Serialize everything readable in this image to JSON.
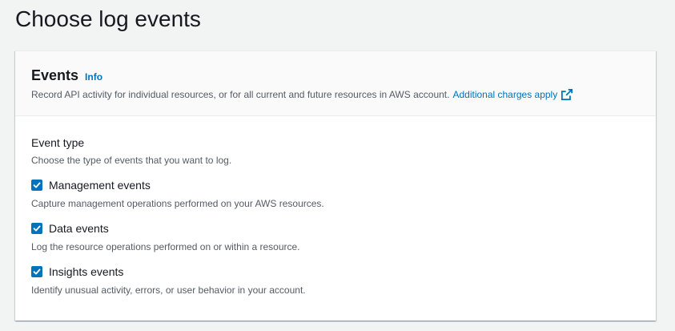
{
  "page": {
    "title": "Choose log events"
  },
  "events_panel": {
    "title": "Events",
    "info_label": "Info",
    "description": "Record API activity for individual resources, or for all current and future resources in AWS account.",
    "charges_link": "Additional charges apply",
    "charges_link_icon": "external-link-icon"
  },
  "event_type": {
    "label": "Event type",
    "description": "Choose the type of events that you want to log.",
    "options": [
      {
        "label": "Management events",
        "description": "Capture management operations performed on your AWS resources.",
        "checked": true
      },
      {
        "label": "Data events",
        "description": "Log the resource operations performed on or within a resource.",
        "checked": true
      },
      {
        "label": "Insights events",
        "description": "Identify unusual activity, errors, or user behavior in your account.",
        "checked": true
      }
    ]
  },
  "colors": {
    "accent": "#0073bb",
    "text": "#16191f",
    "muted": "#545b64",
    "background": "#f2f3f3"
  }
}
